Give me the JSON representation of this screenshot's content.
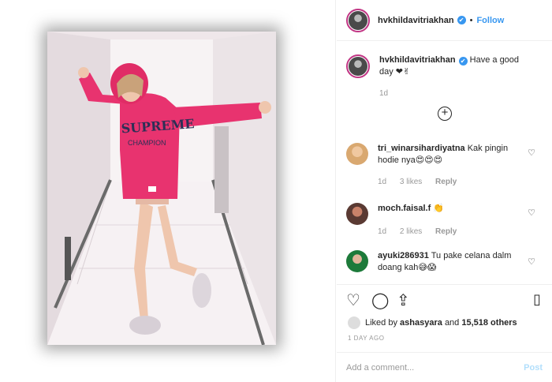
{
  "post": {
    "username": "hvkhildavitriakhan",
    "verified_icon": "verified-badge-icon",
    "follow_label": "Follow",
    "separator": "•",
    "caption": "Have a good day ❤✌",
    "caption_time": "1d",
    "load_more_icon": "plus-circle-icon"
  },
  "comments": [
    {
      "user": "tri_winarsihardiyatna",
      "text": "Kak pingin hodie nya😍😍😍",
      "time": "1d",
      "likes": "3 likes",
      "reply": "Reply"
    },
    {
      "user": "moch.faisal.f",
      "text": "👏",
      "time": "1d",
      "likes": "2 likes",
      "reply": "Reply"
    },
    {
      "user": "ayuki286931",
      "text": "Tu pake celana dalm doang kah😅😱",
      "time": "",
      "likes": "",
      "reply": ""
    }
  ],
  "actions": {
    "icons": [
      "heart-icon",
      "comment-icon",
      "share-icon",
      "bookmark-icon"
    ]
  },
  "likes": {
    "prefix": "Liked by",
    "user": "ashasyara",
    "and": "and",
    "count": "15,518 others"
  },
  "time_ago": "1 DAY AGO",
  "comment_box": {
    "placeholder": "Add a comment...",
    "post_label": "Post"
  },
  "colors": {
    "accent": "#3897f0",
    "hoodie": "#e8336f"
  }
}
